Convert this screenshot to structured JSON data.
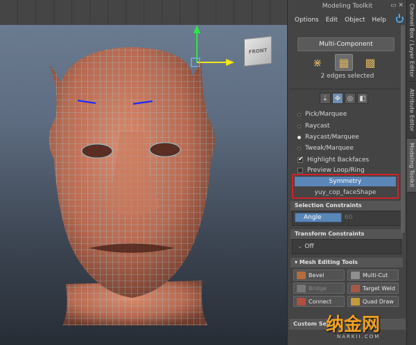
{
  "viewport": {
    "view_cube_label": "FRONT"
  },
  "panel": {
    "title": "Modeling Toolkit",
    "menu": [
      "Options",
      "Edit",
      "Object",
      "Help"
    ],
    "multi_component": "Multi-Component",
    "component_icons": [
      "vertex-icon",
      "edge-icon",
      "face-icon"
    ],
    "selection_status": "2 edges selected",
    "tool_icons": [
      "pick-icon",
      "move-icon",
      "lasso-icon",
      "paint-icon"
    ],
    "selection_modes": [
      "Pick/Marquee",
      "Raycast",
      "Raycast/Marquee",
      "Tweak/Marquee"
    ],
    "selected_mode": "Raycast/Marquee",
    "highlight_backfaces": "Highlight Backfaces",
    "preview_loop": "Preview Loop/Ring",
    "symmetry": "Symmetry",
    "symmetry_shape": "yuy_cop_faceShape",
    "selection_constraints": "Selection Constraints",
    "angle_label": "Angle",
    "angle_value": "60",
    "transform_constraints": "Transform Constraints",
    "transform_value": "Off",
    "mesh_editing_tools": "Mesh Editing Tools",
    "tools": [
      "Bevel",
      "Multi-Cut",
      "Bridge",
      "Target Weld",
      "Connect",
      "Quad Draw"
    ],
    "custom_section": "Custom Sel"
  },
  "side_tabs": [
    "Channel Box / Layer Editor",
    "Attribute Editor",
    "Modeling Toolkit"
  ],
  "watermark": {
    "text": "纳金网",
    "sub": "NARKII.COM"
  },
  "colors": {
    "accent": "#5a86b8",
    "highlight_box": "#d4202a",
    "wire": "#7fe3ff",
    "skin": "#c8775c"
  }
}
